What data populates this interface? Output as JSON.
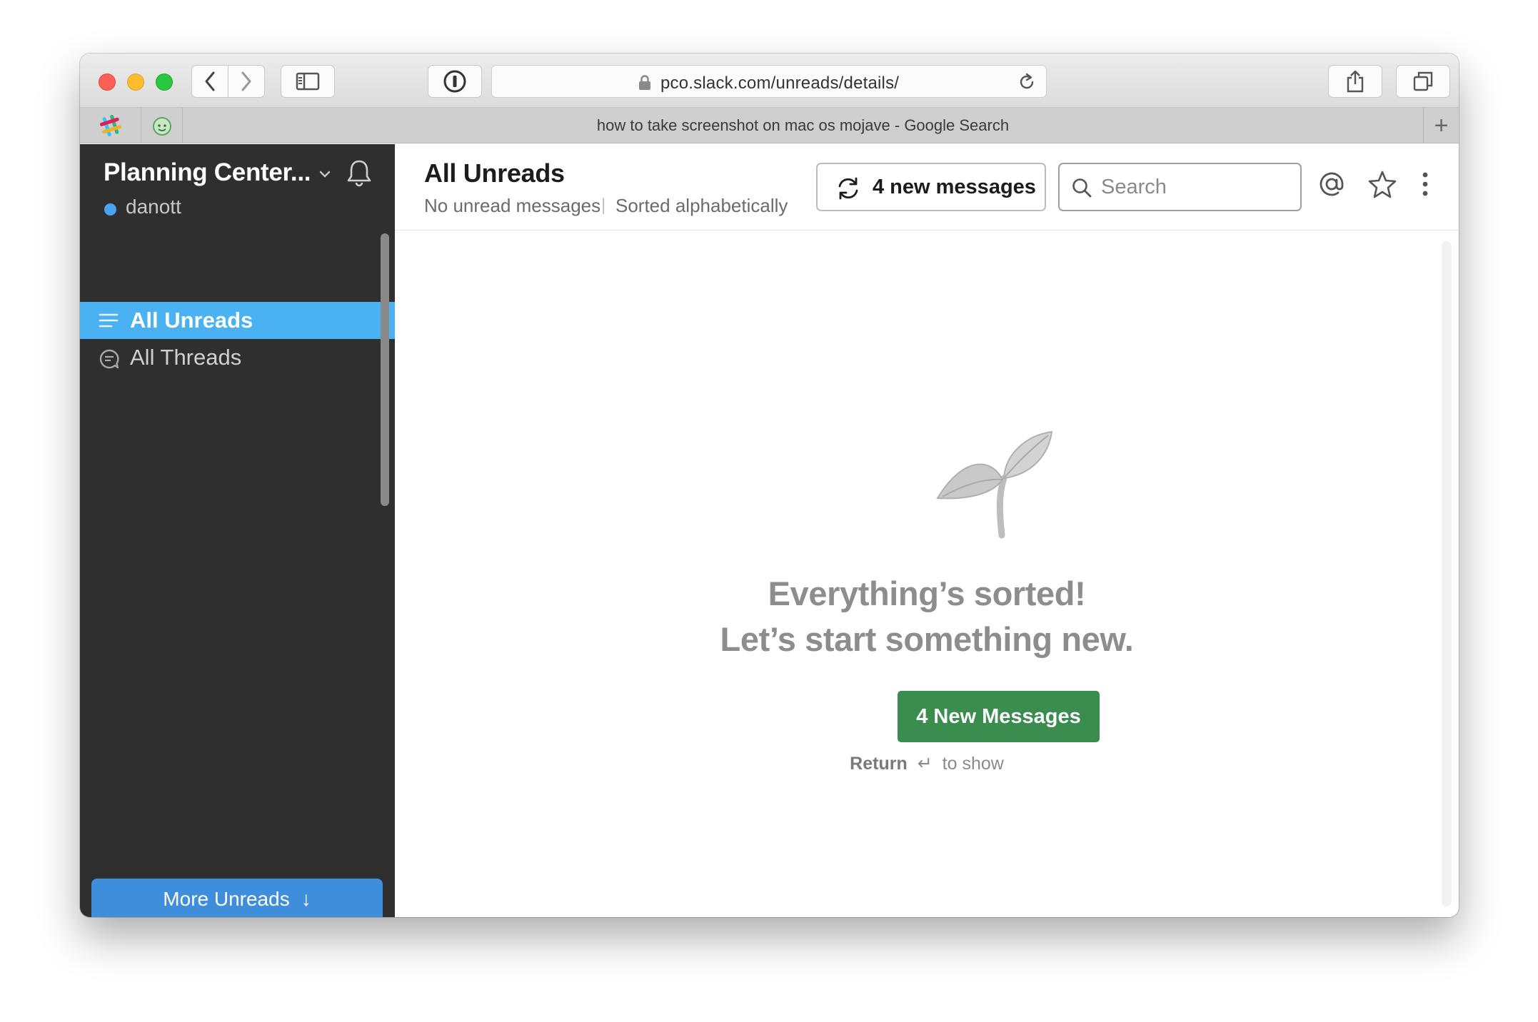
{
  "browser": {
    "url": "pco.slack.com/unreads/details/",
    "active_tab_title": "how to take screenshot on mac os mojave - Google Search",
    "new_tab_label": "+"
  },
  "sidebar": {
    "team_name": "Planning Center...",
    "username": "danott",
    "presence_color": "#4aa3f0",
    "items": [
      {
        "label": "All Unreads",
        "icon": "lines-icon",
        "active": true
      },
      {
        "label": "All Threads",
        "icon": "thread-icon",
        "active": false
      }
    ],
    "more_unreads_label": "More Unreads",
    "more_unreads_arrow": "↓"
  },
  "header": {
    "title": "All Unreads",
    "status": "No unread messages",
    "separator": "|",
    "sort_label": "Sorted alphabetically",
    "new_messages_label": "4 new messages",
    "search_placeholder": "Search"
  },
  "empty_state": {
    "title_line1": "Everything’s sorted!",
    "title_line2": "Let’s start something new.",
    "button_label": "4 New Messages",
    "hint_key": "Return",
    "hint_symbol": "↵",
    "hint_text": "to show"
  },
  "colors": {
    "sidebar_bg": "#2f2f2f",
    "active_item": "#4ab1f2",
    "cta_green": "#3a8c4f",
    "more_unreads_blue": "#3f8edb"
  }
}
